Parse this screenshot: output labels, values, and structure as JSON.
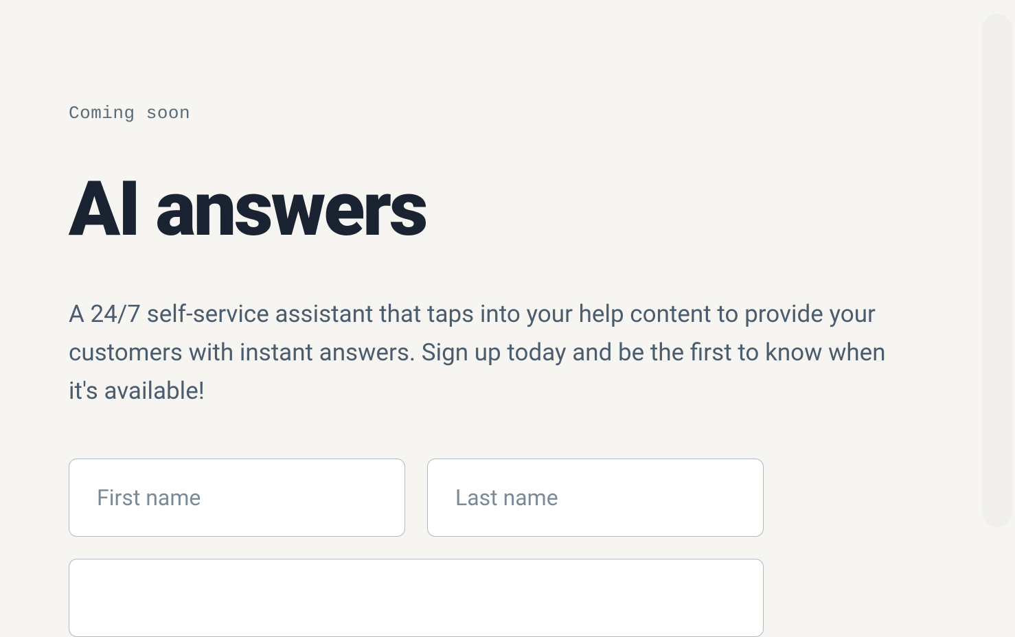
{
  "eyebrow": "Coming soon",
  "headline": "AI answers",
  "description": "A 24/7 self-service assistant that taps into your help content to provide your customers with instant answers. Sign up today and be the first to know when it's available!",
  "form": {
    "first_name": {
      "placeholder": "First name",
      "value": ""
    },
    "last_name": {
      "placeholder": "Last name",
      "value": ""
    }
  }
}
